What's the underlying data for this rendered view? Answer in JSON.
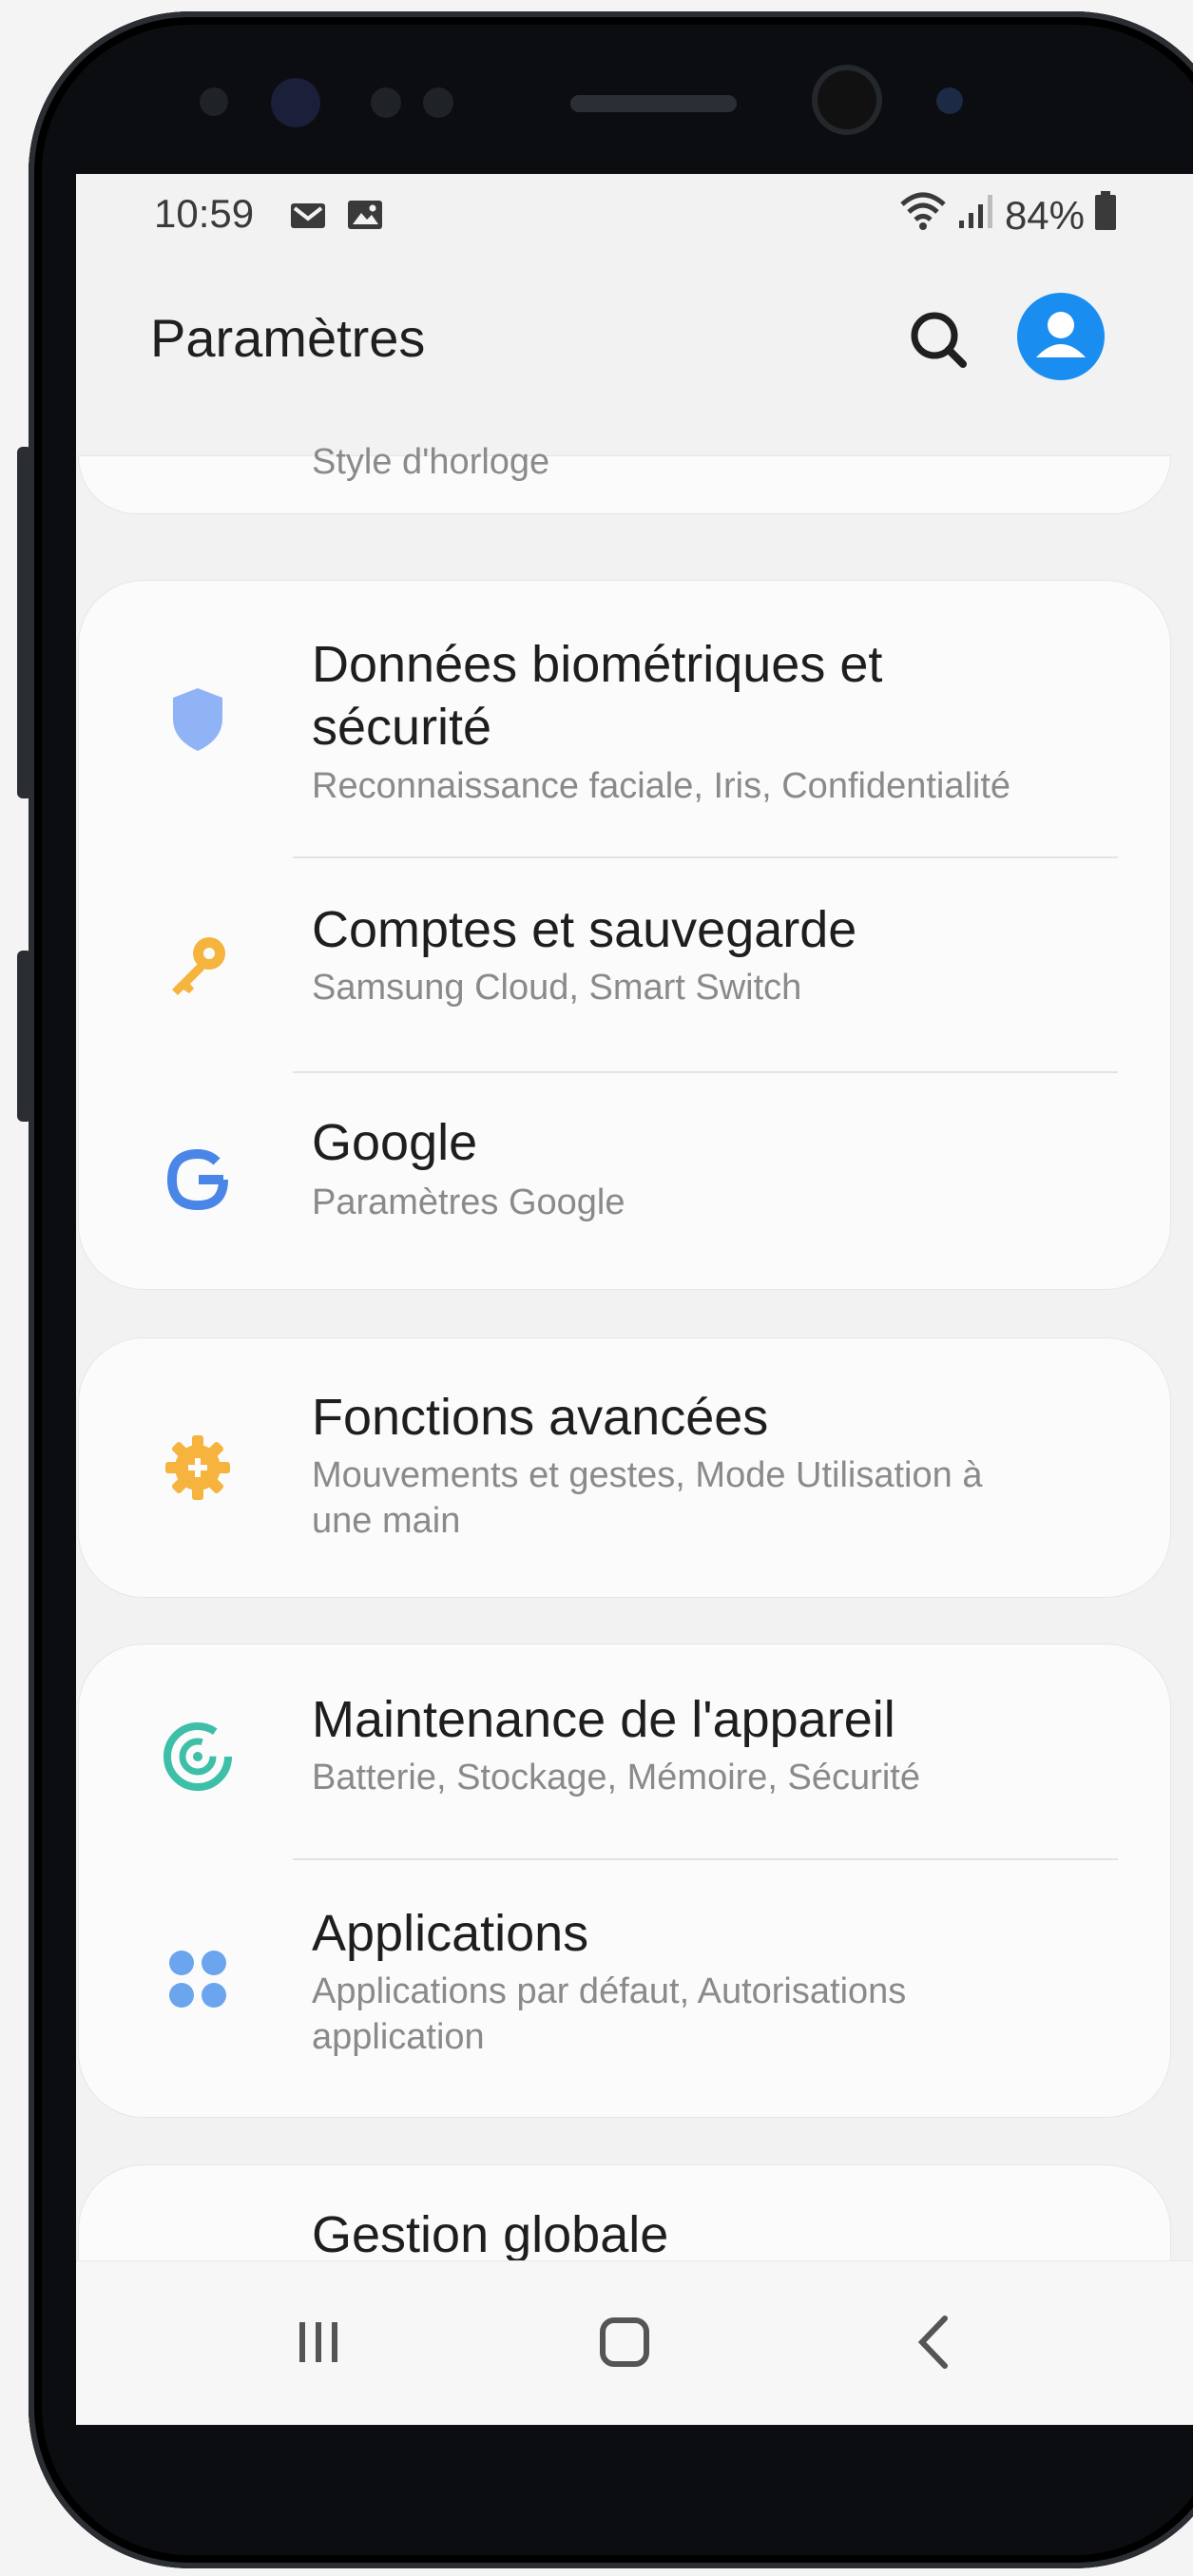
{
  "statusbar": {
    "time": "10:59",
    "icons_left": [
      "gmail-icon",
      "image-icon"
    ],
    "battery": "84%",
    "icons_right": [
      "wifi-icon",
      "signal-icon",
      "battery-icon"
    ]
  },
  "appbar": {
    "title": "Paramètres"
  },
  "partial_top_item": {
    "subtitle": "Style d'horloge"
  },
  "groups": [
    {
      "items": [
        {
          "title_line1": "Données biométriques et",
          "title_line2": "sécurité",
          "subtitle": "Reconnaissance faciale, Iris, Confidentialité",
          "icon": "shield-icon",
          "color": "#8fb3f5"
        },
        {
          "title": "Comptes et sauvegarde",
          "subtitle": "Samsung Cloud, Smart Switch",
          "icon": "key-icon",
          "color": "#f6b33d"
        },
        {
          "title": "Google",
          "subtitle": "Paramètres Google",
          "icon": "google-icon",
          "color": "#4a86e8"
        }
      ]
    },
    {
      "items": [
        {
          "title": "Fonctions avancées",
          "subtitle_line1": "Mouvements et gestes, Mode Utilisation à",
          "subtitle_line2": "une main",
          "icon": "gear-plus-icon",
          "color": "#f6b33d"
        }
      ]
    },
    {
      "items": [
        {
          "title": "Maintenance de l'appareil",
          "subtitle": "Batterie, Stockage, Mémoire, Sécurité",
          "icon": "device-care-icon",
          "color": "#3dbfa8"
        },
        {
          "title": "Applications",
          "subtitle_line1": "Applications par défaut, Autorisations",
          "subtitle_line2": "application",
          "icon": "apps-grid-icon",
          "color": "#6aa5ee"
        }
      ]
    },
    {
      "items": [
        {
          "title": "Gestion globale",
          "icon": "slider-icon",
          "color": "#8fb3f5"
        }
      ]
    }
  ],
  "navbar": {
    "buttons": [
      "recents-icon",
      "home-icon",
      "back-icon"
    ]
  }
}
